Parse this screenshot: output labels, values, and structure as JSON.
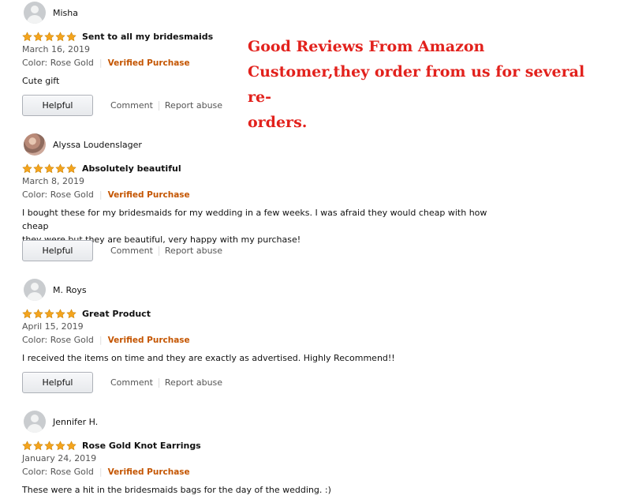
{
  "promo": {
    "line1": "Good Reviews From Amazon",
    "line2": "Customer,they order from us for several re-",
    "line3": "orders.",
    "color": "#e2211c"
  },
  "colors": {
    "star": "#f4a41d",
    "verified": "#c45500"
  },
  "labels": {
    "helpful": "Helpful",
    "comment": "Comment",
    "report": "Report abuse"
  },
  "reviews": [
    {
      "author": "Misha",
      "rating": 5,
      "title": "Sent to all my bridesmaids",
      "date": "March 16, 2019",
      "color": "Color: Rose Gold",
      "verified": "Verified Purchase",
      "text_lines": [
        "Cute gift"
      ]
    },
    {
      "author": "Alyssa Loudenslager",
      "rating": 5,
      "title": "Absolutely beautiful",
      "date": "March 8, 2019",
      "color": "Color: Rose Gold",
      "verified": "Verified Purchase",
      "text_lines": [
        "I bought these for my bridesmaids for my wedding in a few weeks. I was afraid they would cheap with how cheap",
        "they were but they are beautiful, very happy with my purchase!"
      ]
    },
    {
      "author": "M. Roys",
      "rating": 5,
      "title": "Great Product",
      "date": "April 15, 2019",
      "color": "Color: Rose Gold",
      "verified": "Verified Purchase",
      "text_lines": [
        "I received the items on time and they are exactly as advertised. Highly Recommend!!"
      ]
    },
    {
      "author": "Jennifer H.",
      "rating": 5,
      "title": "Rose Gold Knot Earrings",
      "date": "January 24, 2019",
      "color": "Color: Rose Gold",
      "verified": "Verified Purchase",
      "text_lines": [
        "These were a hit in the bridesmaids bags for the day of the wedding. :)"
      ]
    }
  ]
}
